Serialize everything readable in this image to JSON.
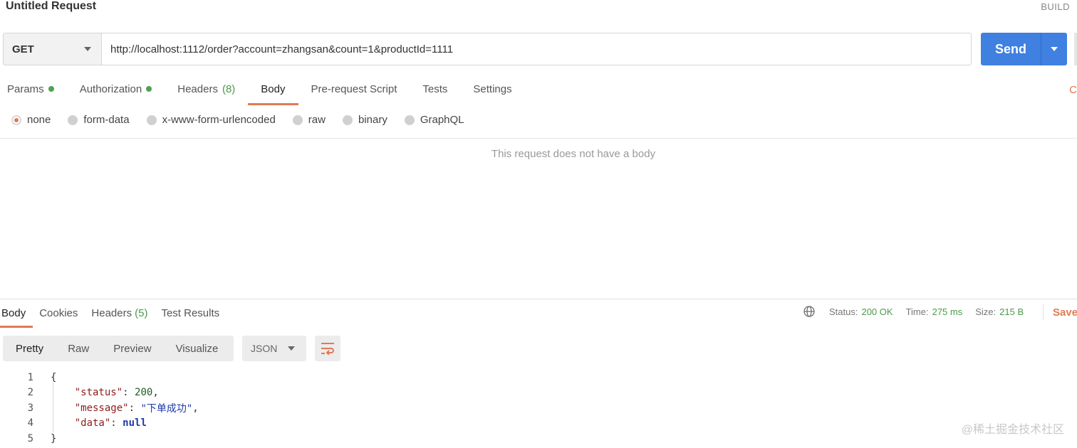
{
  "header": {
    "title": "Untitled Request",
    "build_label": "BUILD"
  },
  "request": {
    "method": "GET",
    "url": "http://localhost:1112/order?account=zhangsan&count=1&productId=1111",
    "send_label": "Send"
  },
  "request_tabs": [
    {
      "label": "Params",
      "has_dot": true
    },
    {
      "label": "Authorization",
      "has_dot": true
    },
    {
      "label": "Headers",
      "count": "(8)"
    },
    {
      "label": "Body",
      "active": true
    },
    {
      "label": "Pre-request Script"
    },
    {
      "label": "Tests"
    },
    {
      "label": "Settings"
    }
  ],
  "body_types": [
    {
      "label": "none",
      "selected": true
    },
    {
      "label": "form-data"
    },
    {
      "label": "x-www-form-urlencoded"
    },
    {
      "label": "raw"
    },
    {
      "label": "binary"
    },
    {
      "label": "GraphQL"
    }
  ],
  "body_empty_message": "This request does not have a body",
  "response": {
    "tabs": [
      {
        "label": "Body",
        "active": true
      },
      {
        "label": "Cookies"
      },
      {
        "label": "Headers",
        "count": "(5)"
      },
      {
        "label": "Test Results"
      }
    ],
    "status_label": "Status:",
    "status_value": "200 OK",
    "time_label": "Time:",
    "time_value": "275 ms",
    "size_label": "Size:",
    "size_value": "215 B",
    "save_label": "Save",
    "view_tabs": [
      "Pretty",
      "Raw",
      "Preview",
      "Visualize"
    ],
    "format": "JSON",
    "code_lines": [
      {
        "n": "1",
        "text": "{"
      },
      {
        "n": "2",
        "key": "\"status\"",
        "sep": ": ",
        "value": "200",
        "vtype": "num",
        "end": ","
      },
      {
        "n": "3",
        "key": "\"message\"",
        "sep": ": ",
        "value": "\"下单成功\"",
        "vtype": "str",
        "end": ","
      },
      {
        "n": "4",
        "key": "\"data\"",
        "sep": ": ",
        "value": "null",
        "vtype": "kw",
        "end": ""
      },
      {
        "n": "5",
        "text": "}"
      }
    ]
  },
  "watermark": "@稀土掘金技术社区",
  "colors": {
    "accent": "#e07a55",
    "send": "#3f80e0",
    "ok": "#4a9a4a"
  },
  "icons": [
    "chevron-down-icon",
    "globe-icon",
    "wrap-lines-icon"
  ]
}
